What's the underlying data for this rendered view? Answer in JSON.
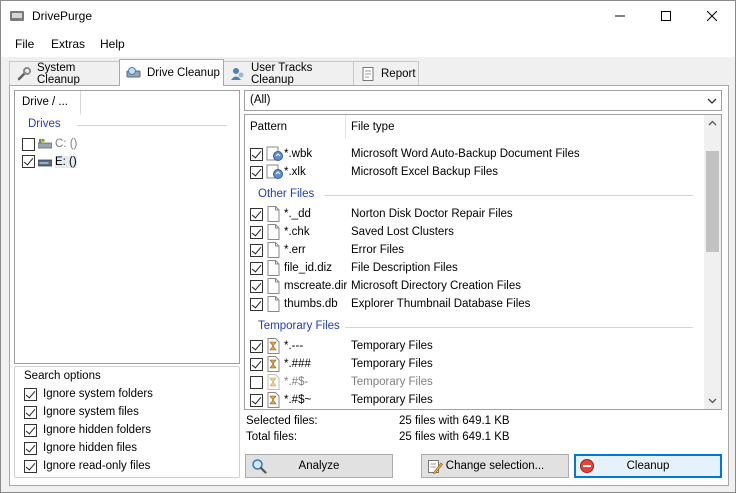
{
  "app": {
    "title": "DrivePurge"
  },
  "menu": {
    "items": [
      "File",
      "Extras",
      "Help"
    ]
  },
  "tabs": [
    {
      "label": "System Cleanup"
    },
    {
      "label": "Drive Cleanup",
      "active": true
    },
    {
      "label": "User Tracks Cleanup"
    },
    {
      "label": "Report"
    }
  ],
  "drive_tree": {
    "header": "Drive / ...",
    "group": "Drives",
    "drives": [
      {
        "label": "C: ()",
        "checked": false
      },
      {
        "label": "E: ()",
        "checked": true
      }
    ]
  },
  "search_options": {
    "title": "Search options",
    "items": [
      {
        "label": "Ignore system folders",
        "checked": true
      },
      {
        "label": "Ignore system files",
        "checked": true
      },
      {
        "label": "Ignore hidden folders",
        "checked": true
      },
      {
        "label": "Ignore hidden files",
        "checked": true
      },
      {
        "label": "Ignore read-only files",
        "checked": true
      }
    ]
  },
  "filter": {
    "value": "(All)"
  },
  "file_list": {
    "columns": [
      "Pattern",
      "File type"
    ],
    "backup_rows": [
      {
        "pattern": "*.wbk",
        "type": "Microsoft Word Auto-Backup Document Files",
        "checked": true
      },
      {
        "pattern": "*.xlk",
        "type": "Microsoft Excel Backup Files",
        "checked": true
      }
    ],
    "other_group": "Other Files",
    "other_rows": [
      {
        "pattern": "*._dd",
        "type": "Norton Disk Doctor Repair Files",
        "checked": true
      },
      {
        "pattern": "*.chk",
        "type": "Saved Lost Clusters",
        "checked": true
      },
      {
        "pattern": "*.err",
        "type": "Error Files",
        "checked": true
      },
      {
        "pattern": "file_id.diz",
        "type": "File Description Files",
        "checked": true
      },
      {
        "pattern": "mscreate.dir",
        "type": "Microsoft Directory Creation Files",
        "checked": true
      },
      {
        "pattern": "thumbs.db",
        "type": "Explorer Thumbnail Database Files",
        "checked": true
      }
    ],
    "temp_group": "Temporary Files",
    "temp_rows": [
      {
        "pattern": "*.---",
        "type": "Temporary Files",
        "checked": true
      },
      {
        "pattern": "*.###",
        "type": "Temporary Files",
        "checked": true
      },
      {
        "pattern": "*.#$-",
        "type": "Temporary Files",
        "checked": false
      },
      {
        "pattern": "*.#$~",
        "type": "Temporary Files",
        "checked": true
      }
    ]
  },
  "stats": {
    "selected_label": "Selected files:",
    "selected_value": "25 files with 649.1 KB",
    "total_label": "Total files:",
    "total_value": "25 files with 649.1 KB"
  },
  "buttons": {
    "analyze": "Analyze",
    "change_selection": "Change selection...",
    "cleanup": "Cleanup"
  },
  "colors": {
    "accent": "#0078d7",
    "group_label": "#1e3cc8"
  }
}
